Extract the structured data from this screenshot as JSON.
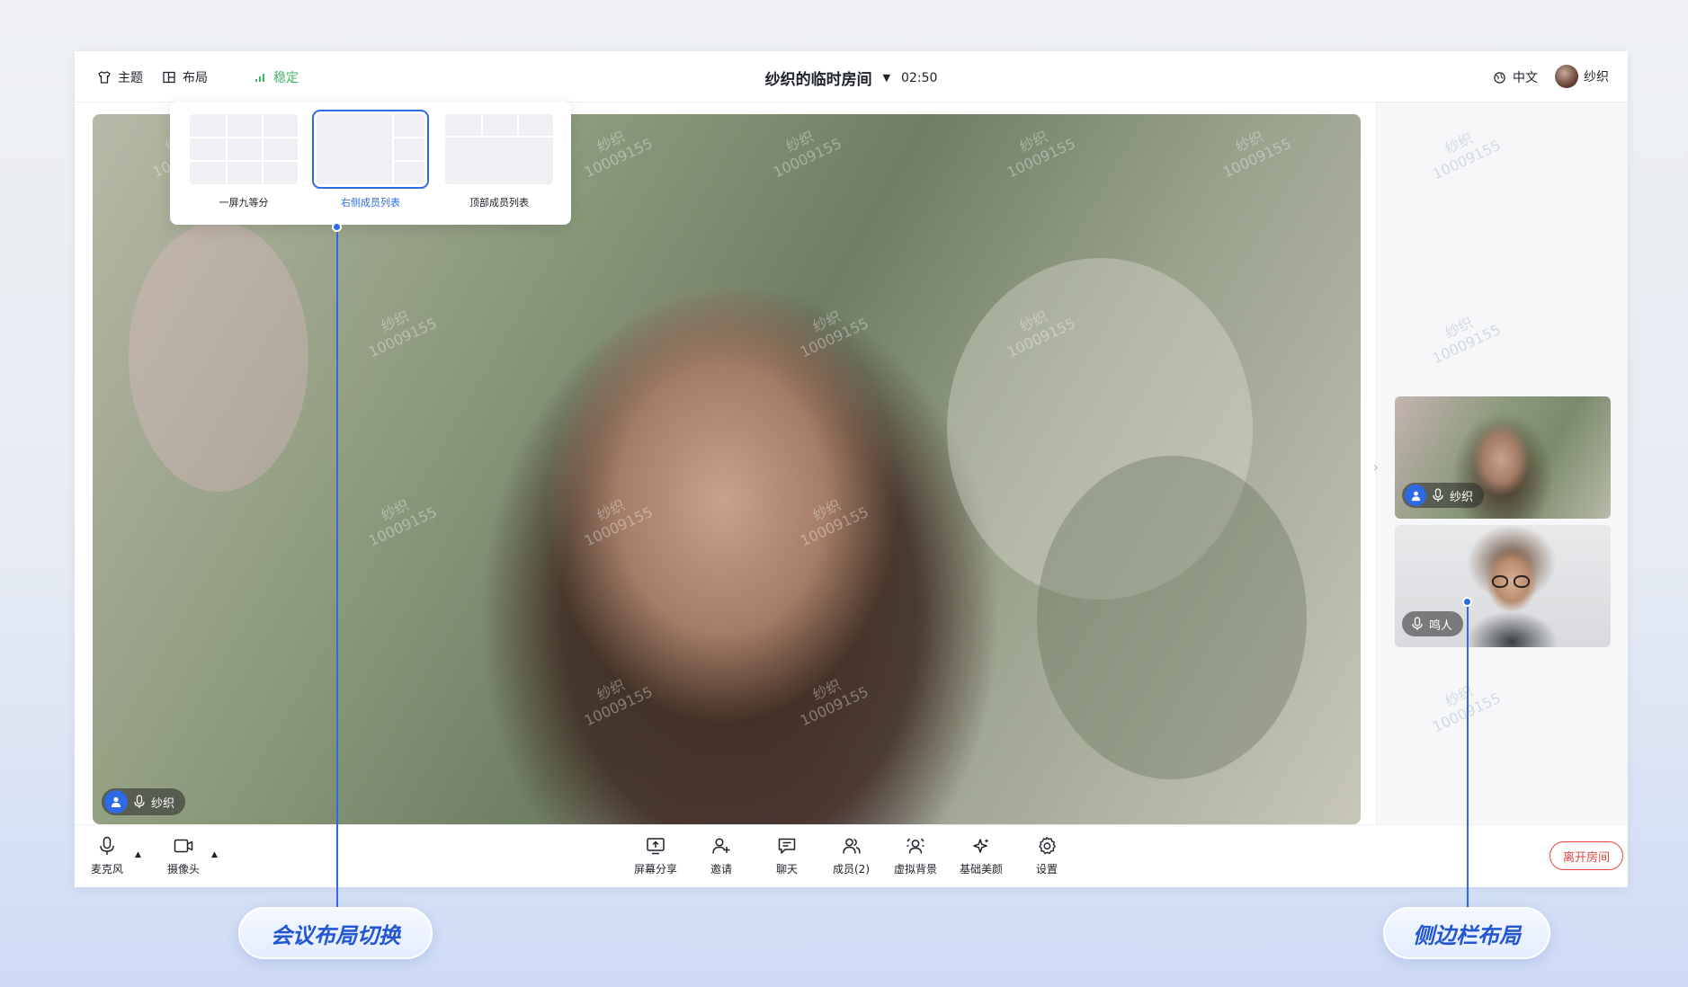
{
  "topbar": {
    "theme_label": "主题",
    "layout_label": "布局",
    "network_status": "稳定",
    "room_title": "纱织的临时房间",
    "room_caret": "▼",
    "timer": "02:50",
    "language": "中文",
    "username": "纱织"
  },
  "layout_popover": {
    "options": [
      {
        "label": "一屏九等分"
      },
      {
        "label": "右侧成员列表"
      },
      {
        "label": "顶部成员列表"
      }
    ],
    "selected": "右侧成员列表"
  },
  "main_video": {
    "name": "纱织",
    "watermark_name": "纱织",
    "watermark_id": "10009155"
  },
  "sidebar": {
    "participants": [
      {
        "name": "纱织"
      },
      {
        "name": "鸣人"
      }
    ],
    "collapse_glyph": "›"
  },
  "toolbar": {
    "mic_label": "麦克风",
    "camera_label": "摄像头",
    "caret": "▲",
    "screen_share_label": "屏幕分享",
    "invite_label": "邀请",
    "chat_label": "聊天",
    "members_label": "成员(2)",
    "virtual_bg_label": "虚拟背景",
    "beauty_label": "基础美颜",
    "settings_label": "设置",
    "leave_label": "离开房间"
  },
  "callouts": {
    "layout_switch": "会议布局切换",
    "sidebar_layout": "侧边栏布局"
  },
  "colors": {
    "accent": "#2e6ae6",
    "stable": "#3fb56a",
    "leave": "#e0443e"
  }
}
